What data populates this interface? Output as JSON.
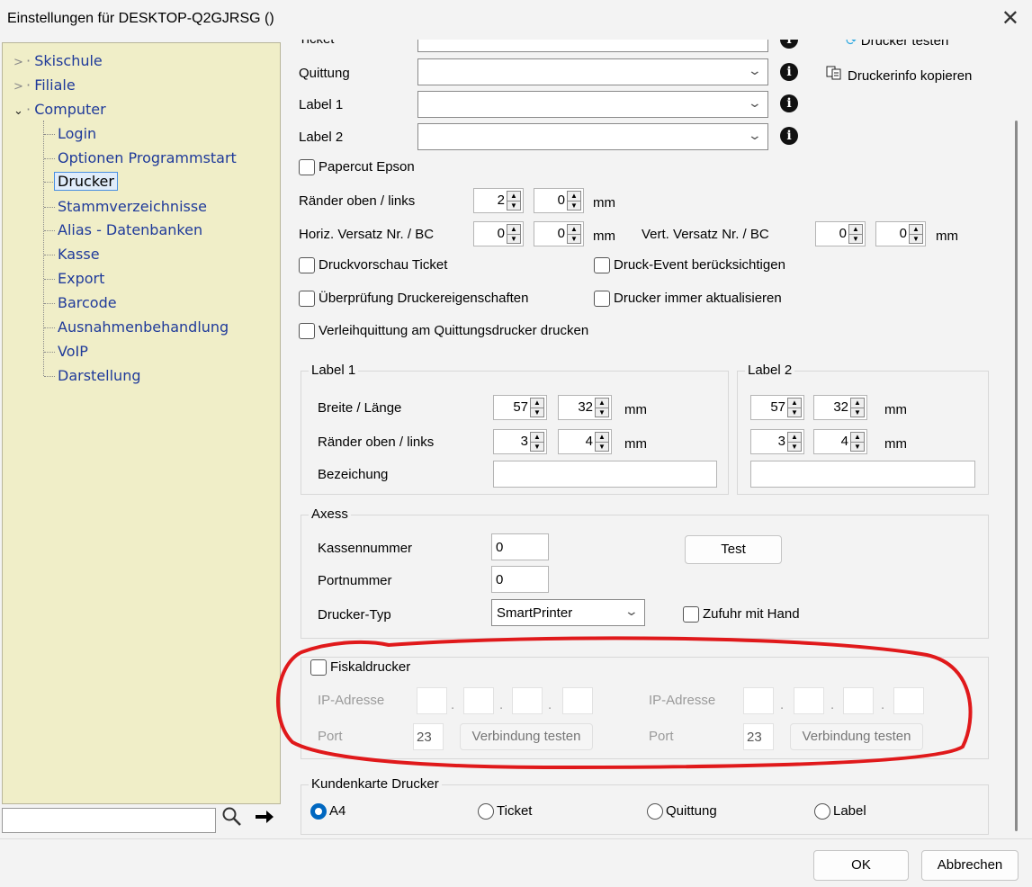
{
  "window": {
    "title": "Einstellungen für DESKTOP-Q2GJRSG ()",
    "close_glyph": "✕"
  },
  "sidebar": {
    "top_items": [
      {
        "label": "Skischule",
        "arrow": ">"
      },
      {
        "label": "Filiale",
        "arrow": ">"
      },
      {
        "label": "Computer",
        "arrow": "v"
      }
    ],
    "children": [
      {
        "label": "Login"
      },
      {
        "label": "Optionen Programmstart"
      },
      {
        "label": "Drucker",
        "selected": true
      },
      {
        "label": "Stammverzeichnisse"
      },
      {
        "label": "Alias - Datenbanken"
      },
      {
        "label": "Kasse"
      },
      {
        "label": "Export"
      },
      {
        "label": "Barcode"
      },
      {
        "label": "Ausnahmenbehandlung"
      },
      {
        "label": "VoIP"
      },
      {
        "label": "Darstellung"
      }
    ],
    "search_value": ""
  },
  "printers": {
    "cut_top_label": "Ticket",
    "quittung_label": "Quittung",
    "label1_label": "Label 1",
    "label2_label": "Label 2",
    "copy_info": "Druckerinfo kopieren",
    "printer_test_cut": "Drucker testen"
  },
  "options": {
    "papercut": "Papercut Epson",
    "margins_label": "Ränder oben / links",
    "margins_top": "2",
    "margins_left": "0",
    "unit": "mm",
    "hoffset_label": "Horiz. Versatz Nr. / BC",
    "hoffset_nr": "0",
    "hoffset_bc": "0",
    "voffset_label": "Vert. Versatz Nr. / BC",
    "voffset_nr": "0",
    "voffset_bc": "0",
    "preview_ticket": "Druckvorschau Ticket",
    "print_event": "Druck-Event berücksichtigen",
    "check_props": "Überprüfung Druckereigenschaften",
    "always_update": "Drucker immer aktualisieren",
    "rental_receipt": "Verleihquittung am Quittungsdrucker drucken"
  },
  "label1": {
    "title": "Label 1",
    "size_label": "Breite / Länge",
    "width": "57",
    "length": "32",
    "margins_label": "Ränder oben / links",
    "top": "3",
    "left": "4",
    "name_label": "Bezeichung",
    "name_value": ""
  },
  "label2": {
    "title": "Label 2",
    "width": "57",
    "length": "32",
    "top": "3",
    "left": "4",
    "name_value": ""
  },
  "axess": {
    "title": "Axess",
    "register_label": "Kassennummer",
    "register_value": "0",
    "port_label": "Portnummer",
    "port_value": "0",
    "type_label": "Drucker-Typ",
    "type_value": "SmartPrinter",
    "test_button": "Test",
    "manual_feed": "Zufuhr mit Hand"
  },
  "fiscal": {
    "checkbox": "Fiskaldrucker",
    "ip_label": "IP-Adresse",
    "port_label": "Port",
    "port1": "23",
    "port2": "23",
    "test_button": "Verbindung testen"
  },
  "card_printer": {
    "title": "Kundenkarte Drucker",
    "options": [
      "A4",
      "Ticket",
      "Quittung",
      "Label"
    ],
    "selected": "A4"
  },
  "footer": {
    "ok": "OK",
    "cancel": "Abbrechen"
  },
  "colors": {
    "sidebar_bg": "#f0eec8",
    "sidebar_text": "#1f3a9a",
    "annotation": "#e0191b",
    "accent": "#0067c0"
  }
}
